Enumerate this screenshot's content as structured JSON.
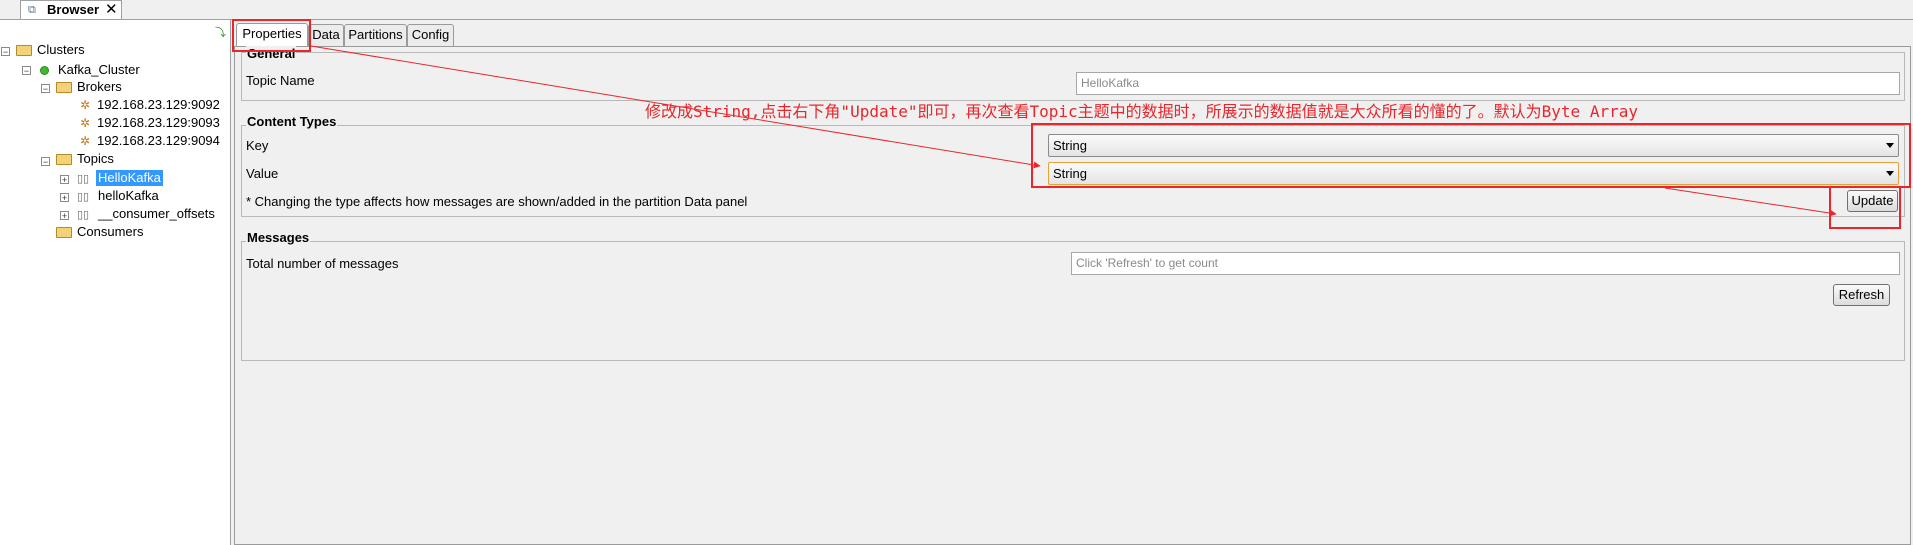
{
  "view_tab": {
    "title": "Browser",
    "close": "✕",
    "icon": "browser-icon"
  },
  "tree": {
    "root": "Clusters",
    "cluster": "Kafka_Cluster",
    "brokers_label": "Brokers",
    "brokers": [
      "192.168.23.129:9092",
      "192.168.23.129:9093",
      "192.168.23.129:9094"
    ],
    "topics_label": "Topics",
    "topics": [
      "HelloKafka",
      "helloKafka",
      "__consumer_offsets"
    ],
    "selected_topic": "HelloKafka",
    "consumers_label": "Consumers"
  },
  "tabs": [
    "Properties",
    "Data",
    "Partitions",
    "Config"
  ],
  "active_tab": "Properties",
  "general": {
    "title": "General",
    "topic_name_label": "Topic Name",
    "topic_name_value": "HelloKafka"
  },
  "content_types": {
    "title": "Content Types",
    "key_label": "Key",
    "key_value": "String",
    "value_label": "Value",
    "value_value": "String",
    "note": "* Changing the type affects how messages are shown/added in the partition Data panel",
    "update_button": "Update"
  },
  "messages": {
    "title": "Messages",
    "total_label": "Total number of messages",
    "total_placeholder": "Click 'Refresh' to get count",
    "refresh_button": "Refresh"
  },
  "annotation": {
    "text": "修改成String,点击右下角\"Update\"即可，再次查看Topic主题中的数据时，所展示的数据值就是大众所看的懂的了。默认为Byte Array",
    "color": "#e8262b"
  }
}
